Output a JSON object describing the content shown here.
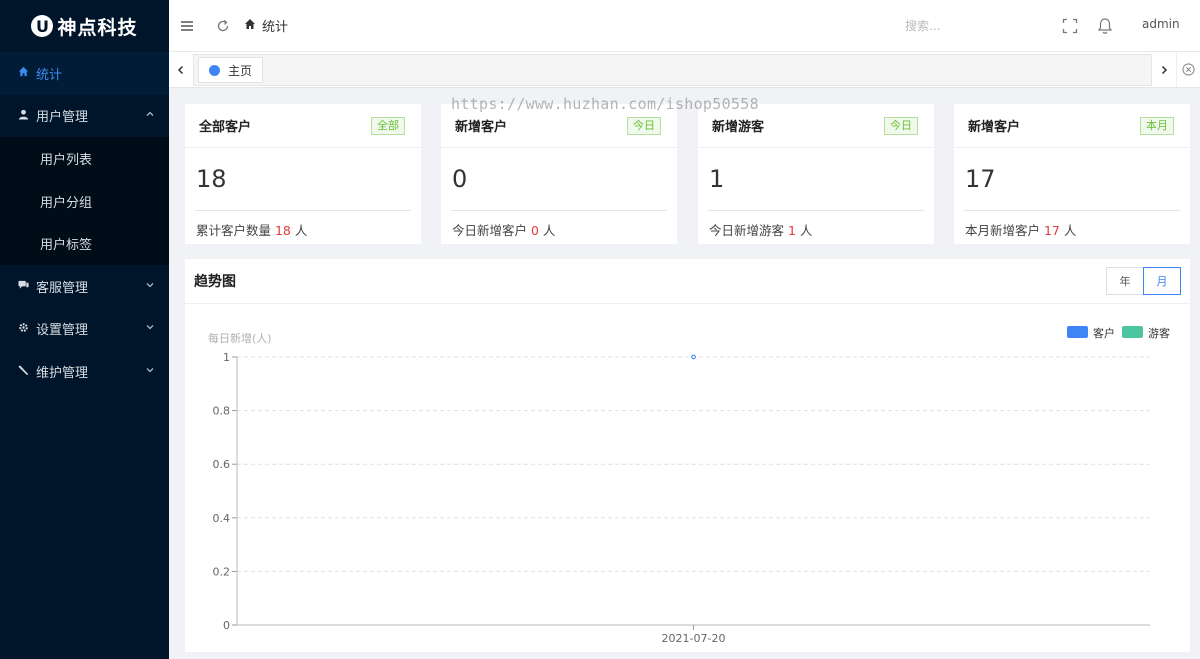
{
  "brand": {
    "logo_letter": "U",
    "name": "神点科技"
  },
  "sidebar": {
    "items": [
      {
        "label": "统计",
        "icon": "home-icon",
        "active": true
      },
      {
        "label": "用户管理",
        "icon": "user-icon",
        "expanded": true,
        "children": [
          {
            "label": "用户列表"
          },
          {
            "label": "用户分组"
          },
          {
            "label": "用户标签"
          }
        ]
      },
      {
        "label": "客服管理",
        "icon": "chat-icon"
      },
      {
        "label": "设置管理",
        "icon": "gear-icon"
      },
      {
        "label": "维护管理",
        "icon": "wrench-icon"
      }
    ]
  },
  "header": {
    "breadcrumb": "统计",
    "search_placeholder": "搜索...",
    "username": "admin"
  },
  "tabs": [
    {
      "label": "主页"
    }
  ],
  "cards": [
    {
      "title": "全部客户",
      "badge": "全部",
      "value": "18",
      "foot_prefix": "累计客户数量 ",
      "foot_num": "18",
      "foot_suffix": " 人"
    },
    {
      "title": "新增客户",
      "badge": "今日",
      "value": "0",
      "foot_prefix": "今日新增客户 ",
      "foot_num": "0",
      "foot_suffix": " 人"
    },
    {
      "title": "新增游客",
      "badge": "今日",
      "value": "1",
      "foot_prefix": "今日新增游客 ",
      "foot_num": "1",
      "foot_suffix": " 人"
    },
    {
      "title": "新增客户",
      "badge": "本月",
      "value": "17",
      "foot_prefix": "本月新增客户 ",
      "foot_num": "17",
      "foot_suffix": " 人"
    }
  ],
  "trend": {
    "title": "趋势图",
    "range_options": [
      {
        "label": "年"
      },
      {
        "label": "月",
        "selected": true
      }
    ]
  },
  "chart_data": {
    "type": "line",
    "title": "",
    "ylabel": "每日新增(人)",
    "xlabel": "",
    "x": [
      "2021-07-20"
    ],
    "ylim": [
      0,
      1
    ],
    "yticks": [
      "0",
      "0.2",
      "0.4",
      "0.6",
      "0.8",
      "1"
    ],
    "grid": true,
    "legend_position": "top-right",
    "series": [
      {
        "name": "客户",
        "values": [
          1
        ],
        "color": "#3d84f5"
      },
      {
        "name": "游客",
        "values": [
          null
        ],
        "color": "#4dc59e"
      }
    ]
  },
  "watermark": "https://www.huzhan.com/ishop50558"
}
